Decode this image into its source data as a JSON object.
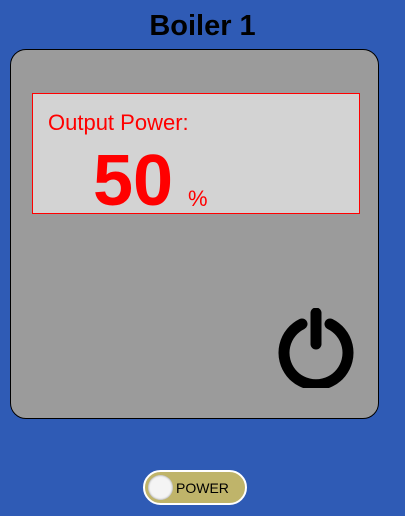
{
  "header": {
    "title": "Boiler 1"
  },
  "panel": {
    "output_label": "Output Power:",
    "output_value": "50",
    "output_unit": "%"
  },
  "controls": {
    "power_icon": "power-icon",
    "toggle_label": "POWER",
    "toggle_state": "off"
  },
  "colors": {
    "background": "#2f5bb5",
    "panel": "#9b9b9b",
    "readout_bg": "#d3d3d3",
    "readout_text": "#ff0000",
    "toggle_track": "#bfb46a"
  }
}
